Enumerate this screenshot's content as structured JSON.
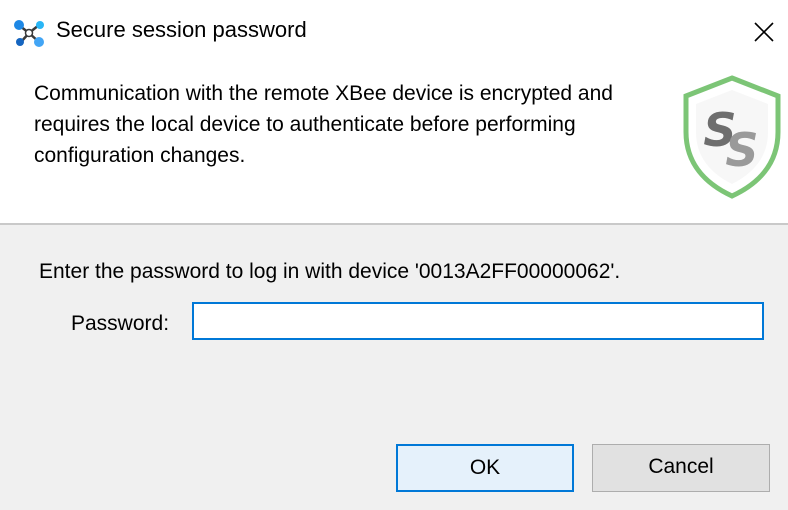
{
  "window": {
    "title": "Secure session password",
    "app_icon": "xbee-network-icon",
    "close_icon": "close-icon"
  },
  "header": {
    "message": "Communication with the remote XBee device is encrypted and requires the local device to authenticate before performing configuration changes.",
    "logo_icon": "secure-session-shield-icon",
    "logo_letters": "SS"
  },
  "form": {
    "prompt": "Enter the password to log in with device '0013A2FF00000062'.",
    "password_label": "Password:",
    "password_value": "",
    "password_placeholder": ""
  },
  "buttons": {
    "ok_label": "OK",
    "cancel_label": "Cancel"
  },
  "colors": {
    "accent": "#0078d7",
    "shield_green": "#7cc576",
    "body_background": "#f0f0f0"
  }
}
